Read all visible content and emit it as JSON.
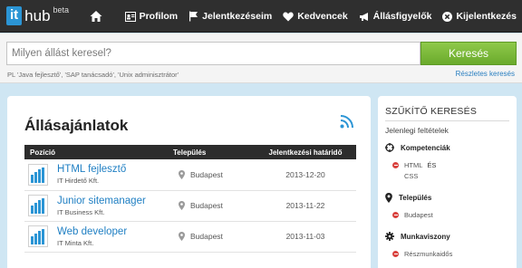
{
  "header": {
    "logo_it": "it",
    "logo_hub": "hub",
    "logo_beta": "beta",
    "nav": [
      {
        "label": "Profilom",
        "icon": "profile-card-icon"
      },
      {
        "label": "Jelentkezéseim",
        "icon": "flag-icon"
      },
      {
        "label": "Kedvencek",
        "icon": "heart-icon"
      },
      {
        "label": "Állásfigyelők",
        "icon": "megaphone-icon"
      },
      {
        "label": "Kijelentkezés",
        "icon": "close-circle-icon"
      }
    ]
  },
  "search": {
    "placeholder": "Milyen állást keresel?",
    "button": "Keresés",
    "hint": "PL 'Java fejlesztő', 'SAP tanácsadó', 'Unix adminisztrátor'",
    "advanced_link": "Részletes keresés"
  },
  "main": {
    "title": "Állásajánlatok",
    "columns": [
      "Pozíció",
      "Település",
      "Jelentkezési határidő"
    ],
    "jobs": [
      {
        "title": "HTML fejlesztő",
        "company": "IT Hirdető Kft.",
        "location": "Budapest",
        "deadline": "2013-12-20"
      },
      {
        "title": "Junior sitemanager",
        "company": "IT Business Kft.",
        "location": "Budapest",
        "deadline": "2013-11-22"
      },
      {
        "title": "Web developer",
        "company": "IT Minta Kft.",
        "location": "Budapest",
        "deadline": "2013-11-03"
      }
    ]
  },
  "sidebar": {
    "title": "SZŰKÍTŐ KERESÉS",
    "subtitle": "Jelenlegi feltételek",
    "sections": {
      "competencies": {
        "label": "Kompetenciák",
        "values": [
          "HTML",
          "CSS"
        ],
        "connector": "ÉS"
      },
      "location": {
        "label": "Település",
        "value": "Budapest"
      },
      "employment": {
        "label": "Munkaviszony",
        "value": "Részmunkaidős"
      }
    }
  },
  "colors": {
    "accent_blue": "#2b95d5",
    "search_green": "#7bbb3b",
    "remove_red": "#d9433f",
    "topbar": "#2f2f2f"
  }
}
